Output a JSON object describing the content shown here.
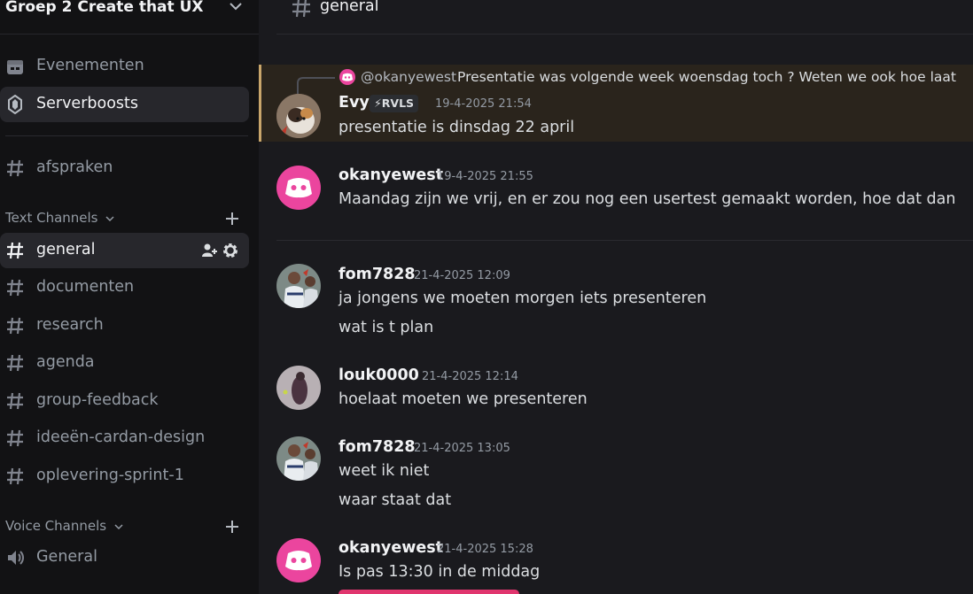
{
  "server": {
    "name": "Groep 2 Create that UX"
  },
  "sidebar": {
    "top_items": [
      {
        "label": "Evenementen",
        "icon": "calendar-icon"
      },
      {
        "label": "Serverboosts",
        "icon": "boost-gem-icon"
      }
    ],
    "pinned_channel": "afspraken",
    "text_category": "Text Channels",
    "text_channels": [
      "general",
      "documenten",
      "research",
      "agenda",
      "group-feedback",
      "ideeën-cardan-design",
      "oplevering-sprint-1"
    ],
    "active_channel": "general",
    "voice_category": "Voice Channels",
    "voice_channels": [
      "General"
    ]
  },
  "channel": {
    "title": "general"
  },
  "messages": {
    "m1": {
      "reply_user": "@okanyewest",
      "reply_text": "Presentatie was volgende week woensdag toch ? Weten we ook hoe laat",
      "author": "Evy",
      "tag": "RVLS",
      "time": "19-4-2025 21:54",
      "text": "presentatie is dinsdag 22 april"
    },
    "m2": {
      "author": "okanyewest",
      "time": "19-4-2025 21:55",
      "text": "Maandag zijn we vrij, en er zou nog een usertest gemaakt worden, hoe dat dan"
    },
    "m3": {
      "author": "fom7828",
      "time": "21-4-2025 12:09",
      "text": "ja jongens we moeten morgen iets presenteren",
      "text2": "wat is t plan"
    },
    "m4": {
      "author": "louk0000",
      "time": "21-4-2025 12:14",
      "text": "hoelaat moeten we presenteren"
    },
    "m5": {
      "author": "fom7828",
      "time": "21-4-2025 13:05",
      "text": "weet ik niet",
      "text2": "waar staat dat"
    },
    "m6": {
      "author": "okanyewest",
      "time": "21-4-2025 15:28",
      "text": "Is pas 13:30 in de middag"
    }
  },
  "colors": {
    "accent_pink": "#eb459e",
    "mention_border": "#c9a66b"
  }
}
